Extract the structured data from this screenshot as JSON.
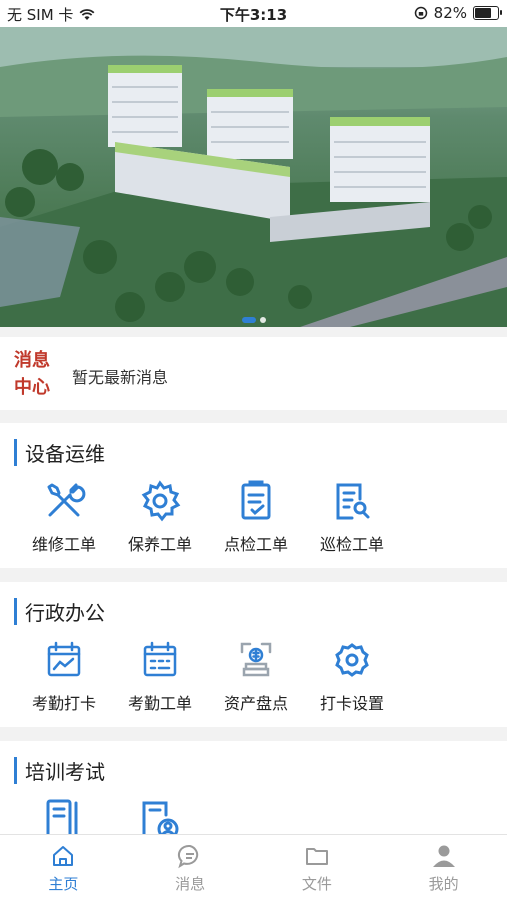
{
  "statusbar": {
    "carrier": "无 SIM 卡",
    "time": "下午3:13",
    "battery": "82%",
    "battery_level": 0.82
  },
  "banner": {
    "slides": 2,
    "active_index": 0
  },
  "message": {
    "title_line1": "消息",
    "title_line2": "中心",
    "text": "暂无最新消息"
  },
  "sections": [
    {
      "title": "设备运维",
      "items": [
        {
          "label": "维修工单",
          "icon": "tools-icon"
        },
        {
          "label": "保养工单",
          "icon": "gear-icon"
        },
        {
          "label": "点检工单",
          "icon": "checklist-icon"
        },
        {
          "label": "巡检工单",
          "icon": "inspect-doc-icon"
        }
      ]
    },
    {
      "title": "行政办公",
      "items": [
        {
          "label": "考勤打卡",
          "icon": "attendance-chart-icon"
        },
        {
          "label": "考勤工单",
          "icon": "calendar-icon"
        },
        {
          "label": "资产盘点",
          "icon": "asset-icon"
        },
        {
          "label": "打卡设置",
          "icon": "settings-icon"
        }
      ]
    },
    {
      "title": "培训考试",
      "items": [
        {
          "label": "",
          "icon": "course-icon"
        },
        {
          "label": "",
          "icon": "exam-icon"
        }
      ]
    }
  ],
  "tabs": [
    {
      "label": "主页",
      "icon": "home-icon",
      "active": true
    },
    {
      "label": "消息",
      "icon": "chat-icon",
      "active": false
    },
    {
      "label": "文件",
      "icon": "folder-icon",
      "active": false
    },
    {
      "label": "我的",
      "icon": "user-icon",
      "active": false
    }
  ],
  "colors": {
    "accent": "#2f7fd4",
    "message_title": "#c0392b",
    "tab_inactive": "#9a9a9a"
  }
}
